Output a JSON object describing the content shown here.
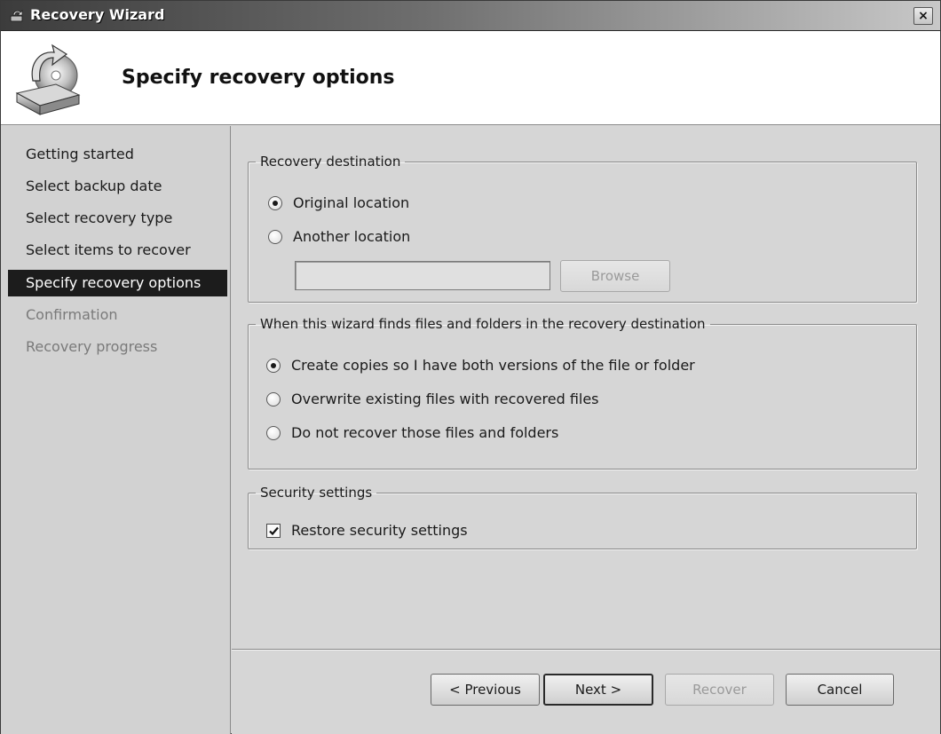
{
  "window": {
    "title": "Recovery Wizard",
    "close_glyph": "×",
    "icon": "backup-app-icon"
  },
  "header": {
    "title": "Specify recovery options",
    "icon": "disk-restore-icon"
  },
  "sidebar": {
    "steps": [
      {
        "label": "Getting started",
        "state": "normal"
      },
      {
        "label": "Select backup date",
        "state": "normal"
      },
      {
        "label": "Select recovery type",
        "state": "normal"
      },
      {
        "label": "Select items to recover",
        "state": "normal"
      },
      {
        "label": "Specify recovery options",
        "state": "active"
      },
      {
        "label": "Confirmation",
        "state": "disabled"
      },
      {
        "label": "Recovery progress",
        "state": "disabled"
      }
    ]
  },
  "destination": {
    "legend": "Recovery destination",
    "options": [
      {
        "label": "Original location",
        "checked": true
      },
      {
        "label": "Another location",
        "checked": false
      }
    ],
    "path_value": "",
    "browse_label": "Browse"
  },
  "conflict": {
    "legend": "When this wizard finds files and folders in the recovery destination",
    "options": [
      {
        "label": "Create copies so I have both versions of the file or folder",
        "checked": true
      },
      {
        "label": "Overwrite existing files with recovered files",
        "checked": false
      },
      {
        "label": "Do not recover those files and folders",
        "checked": false
      }
    ]
  },
  "security": {
    "legend": "Security settings",
    "restore_label": "Restore security settings",
    "restore_checked": true
  },
  "footer": {
    "previous_label": "< Previous",
    "next_label": "Next >",
    "recover_label": "Recover",
    "cancel_label": "Cancel"
  }
}
